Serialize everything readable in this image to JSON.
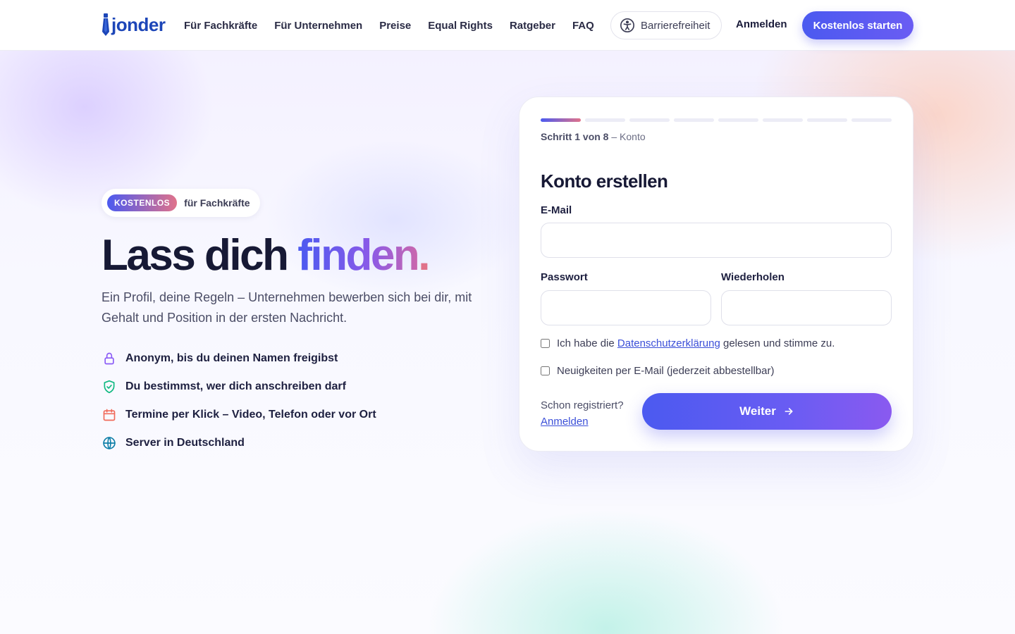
{
  "brand": {
    "name": "jonder"
  },
  "nav": {
    "items": [
      {
        "label": "Für Fachkräfte"
      },
      {
        "label": "Für Unternehmen"
      },
      {
        "label": "Preise"
      },
      {
        "label": "Equal Rights"
      },
      {
        "label": "Ratgeber"
      },
      {
        "label": "FAQ"
      }
    ],
    "accessibility_label": "Barrierefreiheit",
    "login_label": "Anmelden",
    "cta_label": "Kostenlos starten"
  },
  "hero": {
    "badge": "KOSTENLOS",
    "badge_text": "für Fachkräfte",
    "headline_plain": "Lass dich ",
    "headline_accent": "finden",
    "headline_dot": ".",
    "subtitle": "Ein Profil, deine Regeln – Unternehmen bewerben sich bei dir, mit Gehalt und Position in der ersten Nachricht.",
    "features": [
      {
        "icon": "lock-icon",
        "text": "Anonym, bis du deinen Namen freigibst",
        "color": "#8b5cf6"
      },
      {
        "icon": "shield-check-icon",
        "text": "Du bestimmst, wer dich anschreiben darf",
        "color": "#10b981"
      },
      {
        "icon": "calendar-icon",
        "text": "Termine per Klick – Video, Telefon oder vor Ort",
        "color": "#f06a5a"
      },
      {
        "icon": "globe-icon",
        "text": "Server in Deutschland",
        "color": "#0e7fa8"
      }
    ]
  },
  "form": {
    "step_total": 8,
    "step_current": 1,
    "step_prefix": "Schritt 1 von 8",
    "step_suffix": " – Konto",
    "title": "Konto erstellen",
    "email_label": "E-Mail",
    "email_value": "",
    "password_label": "Passwort",
    "password_value": "",
    "repeat_label": "Wiederholen",
    "repeat_value": "",
    "privacy_before": "Ich habe die ",
    "privacy_link": "Datenschutzerklärung",
    "privacy_after": " gelesen und stimme zu.",
    "privacy_checked": false,
    "newsletter_label": "Neuigkeiten per E-Mail (jederzeit abbestellbar)",
    "newsletter_checked": false,
    "already_text": "Schon registriert?",
    "already_link": "Anmelden",
    "submit_label": "Weiter"
  },
  "colors": {
    "primary": "#4b5af0",
    "accent_pink": "#e0728a",
    "logo_blue": "#1d46b8"
  }
}
